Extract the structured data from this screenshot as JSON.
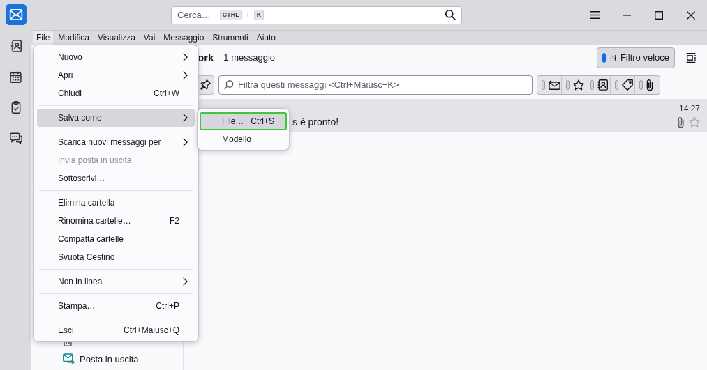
{
  "window": {
    "search": {
      "placeholder": "Cerca…",
      "keys": [
        "CTRL",
        "K"
      ],
      "joiner": "+"
    }
  },
  "spaces": [
    {
      "kind": "mail",
      "selected": true
    },
    {
      "kind": "address_book",
      "selected": false
    },
    {
      "kind": "calendar",
      "selected": false
    },
    {
      "kind": "tasks",
      "selected": false
    },
    {
      "kind": "chat",
      "selected": false
    }
  ],
  "menubar": [
    {
      "label": "File",
      "selected": true
    },
    {
      "label": "Modifica",
      "selected": false
    },
    {
      "label": "Visualizza",
      "selected": false
    },
    {
      "label": "Vai",
      "selected": false
    },
    {
      "label": "Messaggio",
      "selected": false
    },
    {
      "label": "Strumenti",
      "selected": false
    },
    {
      "label": "Aiuto",
      "selected": false
    }
  ],
  "file_menu": [
    {
      "kind": "item",
      "label": "Nuovo",
      "submenu": true,
      "disabled": false,
      "selected": false
    },
    {
      "kind": "item",
      "label": "Apri",
      "submenu": true,
      "disabled": false,
      "selected": false
    },
    {
      "kind": "item",
      "label": "Chiudi",
      "shortcut": "Ctrl+W",
      "submenu": false,
      "disabled": false,
      "selected": false
    },
    {
      "kind": "separator"
    },
    {
      "kind": "item",
      "label": "Salva come",
      "submenu": true,
      "disabled": false,
      "selected": true
    },
    {
      "kind": "separator"
    },
    {
      "kind": "item",
      "label": "Scarica nuovi messaggi per",
      "submenu": true,
      "disabled": false,
      "selected": false
    },
    {
      "kind": "item",
      "label": "Invia posta in uscita",
      "submenu": false,
      "disabled": true,
      "selected": false
    },
    {
      "kind": "item",
      "label": "Sottoscrivi…",
      "submenu": false,
      "disabled": false,
      "selected": false
    },
    {
      "kind": "separator"
    },
    {
      "kind": "item",
      "label": "Elimina cartella",
      "submenu": false,
      "disabled": false,
      "selected": false
    },
    {
      "kind": "item",
      "label": "Rinomina cartelle…",
      "shortcut": "F2",
      "submenu": false,
      "disabled": false,
      "selected": false
    },
    {
      "kind": "item",
      "label": "Compatta cartelle",
      "submenu": false,
      "disabled": false,
      "selected": false
    },
    {
      "kind": "item",
      "label": "Svuota Cestino",
      "submenu": false,
      "disabled": false,
      "selected": false
    },
    {
      "kind": "separator"
    },
    {
      "kind": "item",
      "label": "Non in linea",
      "submenu": true,
      "disabled": false,
      "selected": false
    },
    {
      "kind": "separator"
    },
    {
      "kind": "item",
      "label": "Stampa…",
      "shortcut": "Ctrl+P",
      "submenu": false,
      "disabled": false,
      "selected": false
    },
    {
      "kind": "separator"
    },
    {
      "kind": "item",
      "label": "Esci",
      "shortcut": "Ctrl+Maiusc+Q",
      "submenu": false,
      "disabled": false,
      "selected": false
    }
  ],
  "save_as_menu": [
    {
      "label": "File…",
      "shortcut": "Ctrl+S",
      "selected": true
    },
    {
      "label": "Modello",
      "selected": false
    }
  ],
  "folder_pane": {
    "items": [
      {
        "kind": "trash"
      },
      {
        "kind": "outbox",
        "label": "Posta in uscita"
      }
    ]
  },
  "message_list": {
    "folder": "ork",
    "count": "1 messaggio",
    "quick_filter_button": {
      "label": "Filtro veloce",
      "on": true
    },
    "filter_field": {
      "placeholder": "Filtra questi messaggi <Ctrl+Maiusc+K>"
    },
    "filter_toggles": [
      {
        "kind": "unread",
        "on": false
      },
      {
        "kind": "starred",
        "on": false
      },
      {
        "kind": "contact",
        "on": false
      },
      {
        "kind": "tags",
        "on": false
      },
      {
        "kind": "attachment",
        "on": false
      }
    ],
    "rows": [
      {
        "subject": "s è pronto!",
        "time": "14:27",
        "attachment": true,
        "starred": false,
        "selected": true
      }
    ]
  }
}
